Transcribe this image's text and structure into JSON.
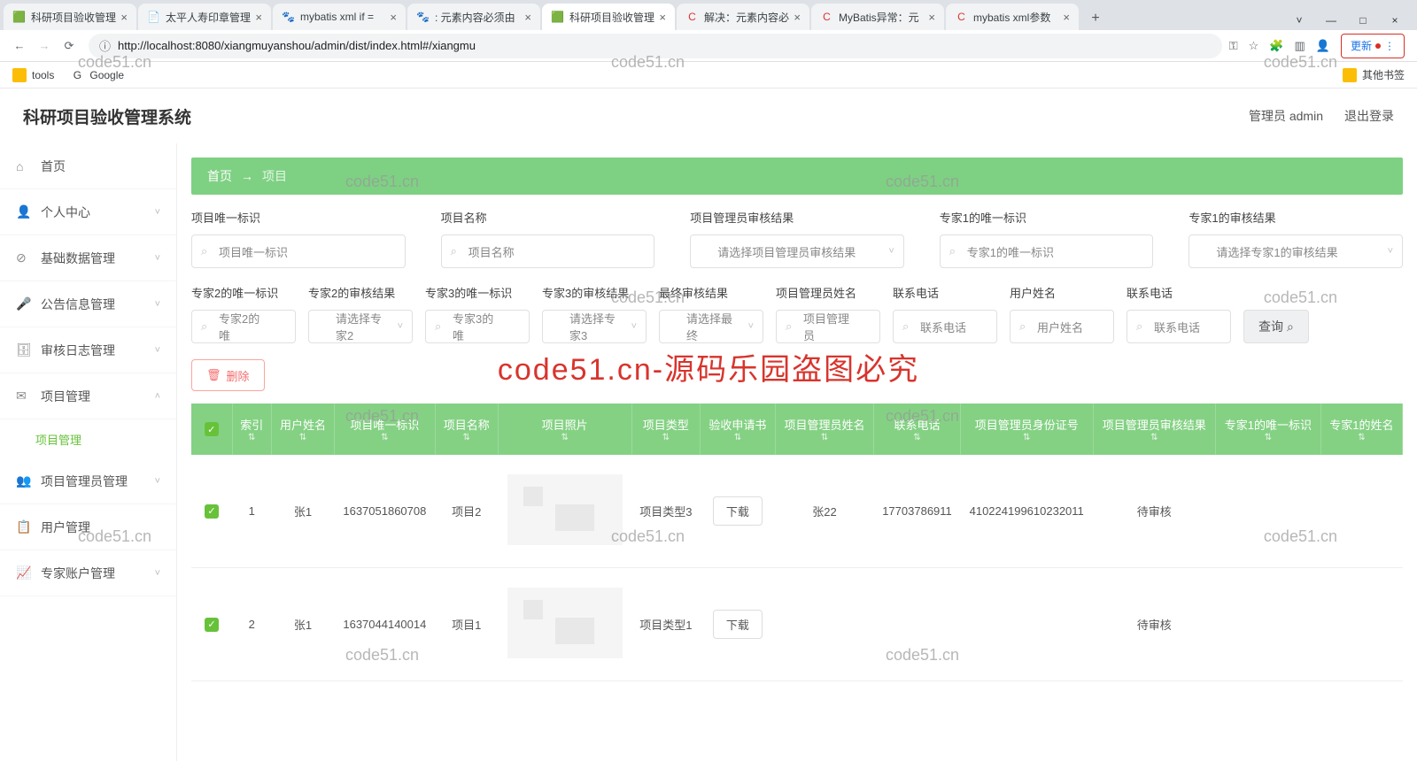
{
  "browser": {
    "tabs": [
      {
        "label": "科研项目验收管理"
      },
      {
        "label": "太平人寿印章管理"
      },
      {
        "label": "mybatis xml if ="
      },
      {
        "label": ": 元素内容必须由"
      },
      {
        "label": "科研项目验收管理",
        "active": true
      },
      {
        "label": "解决：元素内容必"
      },
      {
        "label": "MyBatis异常：元"
      },
      {
        "label": "mybatis xml参数"
      }
    ],
    "url": "http://localhost:8080/xiangmuyanshou/admin/dist/index.html#/xiangmu",
    "update": "更新"
  },
  "bookmarks": {
    "tools": "tools",
    "google": "Google",
    "other": "其他书签"
  },
  "header": {
    "title": "科研项目验收管理系统",
    "user": "管理员 admin",
    "logout": "退出登录"
  },
  "sidebar": [
    {
      "icon": "⌂",
      "label": "首页"
    },
    {
      "icon": "👤",
      "label": "个人中心",
      "arrow": true
    },
    {
      "icon": "⊘",
      "label": "基础数据管理",
      "arrow": true
    },
    {
      "icon": "🎤",
      "label": "公告信息管理",
      "arrow": true
    },
    {
      "icon": "🗄",
      "label": "审核日志管理",
      "arrow": true
    },
    {
      "icon": "✉",
      "label": "项目管理",
      "arrow": true,
      "open": true,
      "sub": "项目管理"
    },
    {
      "icon": "👥",
      "label": "项目管理员管理",
      "arrow": true
    },
    {
      "icon": "📋",
      "label": "用户管理"
    },
    {
      "icon": "📈",
      "label": "专家账户管理",
      "arrow": true
    }
  ],
  "breadcrumb": {
    "home": "首页",
    "sep": "→",
    "current": "项目"
  },
  "filters1": [
    {
      "label": "项目唯一标识",
      "ph": "项目唯一标识",
      "type": "input"
    },
    {
      "label": "项目名称",
      "ph": "项目名称",
      "type": "input"
    },
    {
      "label": "项目管理员审核结果",
      "ph": "请选择项目管理员审核结果",
      "type": "select"
    },
    {
      "label": "专家1的唯一标识",
      "ph": "专家1的唯一标识",
      "type": "input"
    },
    {
      "label": "专家1的审核结果",
      "ph": "请选择专家1的审核结果",
      "type": "select"
    }
  ],
  "filters2": [
    {
      "label": "专家2的唯一标识",
      "ph": "专家2的唯",
      "type": "input"
    },
    {
      "label": "专家2的审核结果",
      "ph": "请选择专家2",
      "type": "select"
    },
    {
      "label": "专家3的唯一标识",
      "ph": "专家3的唯",
      "type": "input"
    },
    {
      "label": "专家3的审核结果",
      "ph": "请选择专家3",
      "type": "select"
    },
    {
      "label": "最终审核结果",
      "ph": "请选择最终",
      "type": "select"
    },
    {
      "label": "项目管理员姓名",
      "ph": "项目管理员",
      "type": "input"
    },
    {
      "label": "联系电话",
      "ph": "联系电话",
      "type": "input"
    },
    {
      "label": "用户姓名",
      "ph": "用户姓名",
      "type": "input"
    },
    {
      "label": "联系电话",
      "ph": "联系电话",
      "type": "input"
    }
  ],
  "searchBtn": "查询",
  "deleteBtn": "删除",
  "columns": [
    "",
    "索引",
    "用户姓名",
    "项目唯一标识",
    "项目名称",
    "项目照片",
    "项目类型",
    "验收申请书",
    "项目管理员姓名",
    "联系电话",
    "项目管理员身份证号",
    "项目管理员审核结果",
    "专家1的唯一标识",
    "专家1的姓名"
  ],
  "rows": [
    {
      "idx": "1",
      "user": "张1",
      "uid": "1637051860708",
      "name": "项目2",
      "type": "项目类型3",
      "dl": "下载",
      "pm": "张22",
      "tel": "17703786911",
      "idno": "410224199610232011",
      "res": "待审核"
    },
    {
      "idx": "2",
      "user": "张1",
      "uid": "1637044140014",
      "name": "项目1",
      "type": "项目类型1",
      "dl": "下载",
      "pm": "",
      "tel": "",
      "idno": "",
      "res": "待审核"
    }
  ],
  "watermarks": "code51.cn",
  "bigWatermark": "code51.cn-源码乐园盗图必究"
}
